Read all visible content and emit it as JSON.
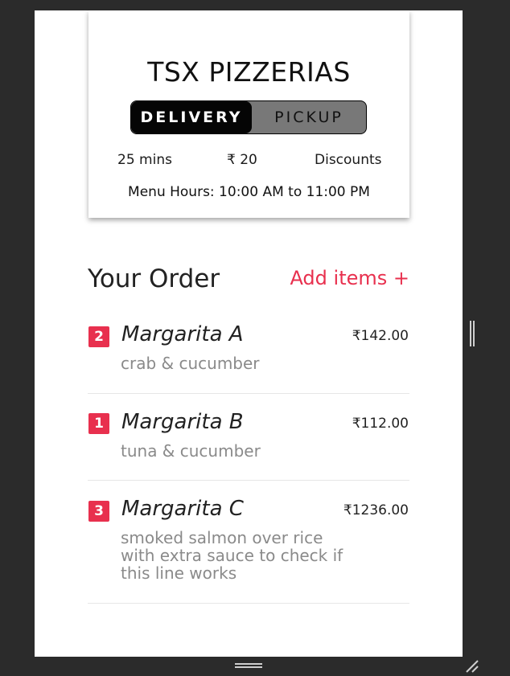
{
  "store": {
    "name": "TSX PIZZERIAS",
    "toggle": {
      "delivery_label": "DELIVERY",
      "pickup_label": "PICKUP",
      "selected": "DELIVERY"
    },
    "info": {
      "time": "25 mins",
      "fee": "₹ 20",
      "discounts": "Discounts"
    },
    "hours": "Menu Hours: 10:00 AM to 11:00 PM"
  },
  "order": {
    "title": "Your Order",
    "add_items_label": "Add items +",
    "items": [
      {
        "qty": "2",
        "name": "Margarita A",
        "price": "₹142.00",
        "desc": "crab & cucumber"
      },
      {
        "qty": "1",
        "name": "Margarita B",
        "price": "₹112.00",
        "desc": "tuna & cucumber"
      },
      {
        "qty": "3",
        "name": "Margarita C",
        "price": "₹1236.00",
        "desc": "smoked salmon over rice with extra sauce to check if this line works"
      }
    ]
  },
  "colors": {
    "accent": "#e8304e",
    "toggle_selected_bg": "#050505",
    "toggle_unselected_bg": "#787878",
    "background": "#2b2b2b"
  },
  "icons": {
    "side_handle": "vertical-drag-handle-icon",
    "bottom_handle": "horizontal-drag-handle-icon",
    "resize": "resize-corner-icon"
  }
}
